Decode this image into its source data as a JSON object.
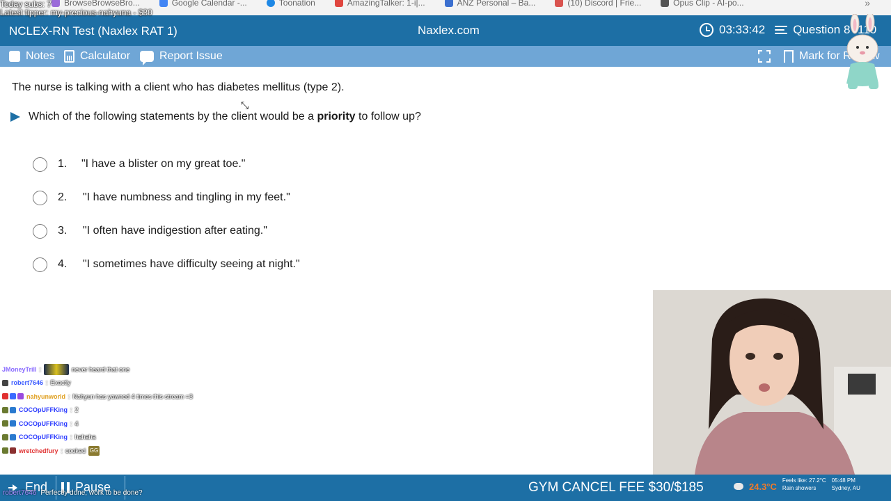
{
  "overlay": {
    "subs_line": "Today subs: 7",
    "tipper_line": "Latest tipper: my-precious-nahyuna - $30"
  },
  "browser": {
    "bookmarks": [
      {
        "label": "BrowseBrowseBro...",
        "icon": "purple-square-icon"
      },
      {
        "label": "Google Calendar -...",
        "icon": "calendar-icon"
      },
      {
        "label": "Toonation",
        "icon": "toonation-icon"
      },
      {
        "label": "AmazingTalker: 1-i|...",
        "icon": "amazingtalker-icon"
      },
      {
        "label": "ANZ Personal – Ba...",
        "icon": "anz-icon"
      },
      {
        "label": "(10) Discord | Frie...",
        "icon": "discord-icon"
      },
      {
        "label": "Opus Clip - AI-po...",
        "icon": "opus-icon"
      }
    ],
    "more_label": "»"
  },
  "header": {
    "test_title": "NCLEX-RN Test (Naxlex RAT 1)",
    "site": "Naxlex.com",
    "timer": "03:33:42",
    "question_label": "Question 8",
    "question_total": "110"
  },
  "toolbar": {
    "notes": "Notes",
    "calculator": "Calculator",
    "report": "Report Issue",
    "mark": "Mark for Review"
  },
  "question": {
    "stem": "The nurse is talking with a client who has diabetes mellitus (type 2).",
    "prompt_before": "Which of the following statements by the client would be a ",
    "prompt_bold": "priority",
    "prompt_after": " to follow up?",
    "options": [
      {
        "num": "1.",
        "text": "\"I have a blister on my great toe.\""
      },
      {
        "num": "2.",
        "text": "\"I have numbness and tingling in my feet.\""
      },
      {
        "num": "3.",
        "text": "\"I often have indigestion after eating.\""
      },
      {
        "num": "4.",
        "text": "\"I sometimes have difficulty seeing at night.\""
      }
    ]
  },
  "chat": {
    "messages": [
      {
        "user": "JMoneyTrill",
        "color": "#8a6cff",
        "msg": "never heard that one",
        "emote": true
      },
      {
        "user": "robert7646",
        "color": "#3a5aff",
        "msg": "Exactly"
      },
      {
        "user": "nahyunworld",
        "color": "#e0a020",
        "msg": "Nahyun has yawned 4 times this stream =3"
      },
      {
        "user": "COCOpUFFKing",
        "color": "#2a3aff",
        "msg": "2"
      },
      {
        "user": "COCOpUFFKing",
        "color": "#2a3aff",
        "msg": "4"
      },
      {
        "user": "COCOpUFFKing",
        "color": "#2a3aff",
        "msg": "hahaha"
      },
      {
        "user": "wretchedfury",
        "color": "#e03030",
        "msg": "cooked",
        "emote_small": "GG"
      }
    ],
    "ticker_user": "robert7646",
    "ticker_msg": "Perfectly done, work to be done?"
  },
  "footer": {
    "end": "End",
    "pause": "Pause",
    "gym": "GYM CANCEL FEE $30/$185",
    "weather_temp": "24.3°C",
    "feels": "Feels like: 27.2°C",
    "condition": "Rain showers",
    "time": "05:48 PM",
    "location": "Sydney, AU"
  },
  "colors": {
    "header_bg": "#1d6fa5",
    "toolbar_bg": "#6fa6d6",
    "accent": "#1d6fa5"
  }
}
